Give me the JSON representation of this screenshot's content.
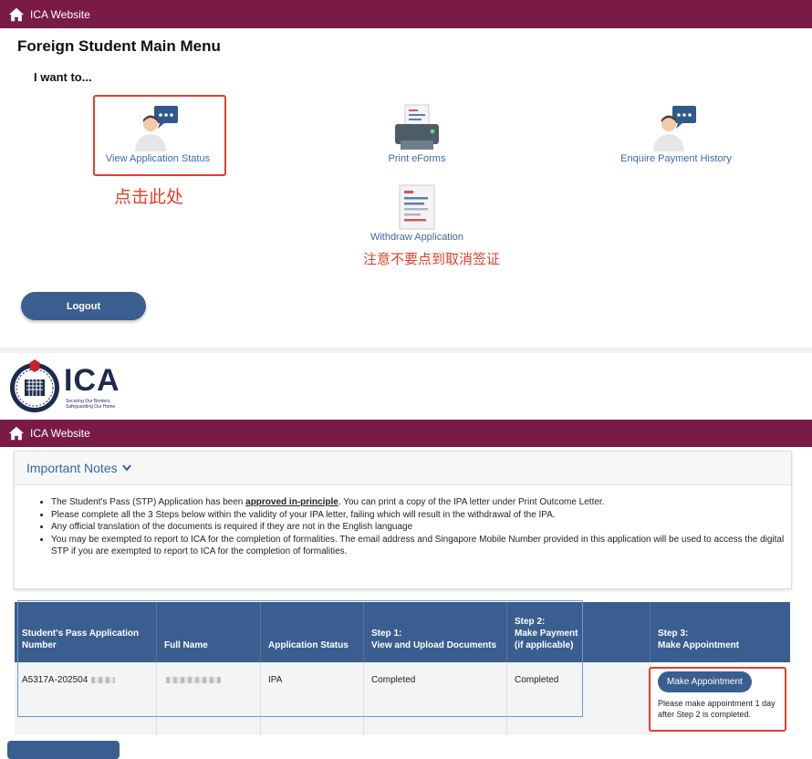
{
  "top_bar": {
    "label": "ICA Website"
  },
  "menu": {
    "title": "Foreign Student Main Menu",
    "subtitle": "I want to...",
    "tiles": [
      {
        "label": "View Application Status",
        "icon": "person-chat-icon"
      },
      {
        "label": "Print eForms",
        "icon": "printer-icon"
      },
      {
        "label": "Enquire Payment History",
        "icon": "person-chat-icon"
      },
      {
        "label": "Withdraw Application",
        "icon": "document-icon"
      }
    ],
    "annotation_click": "点击此处",
    "annotation_warning": "注意不要点到取消签证",
    "logout_label": "Logout"
  },
  "logo": {
    "text": "ICA",
    "tagline": "Securing Our Borders, Safeguarding Our Home"
  },
  "second_bar": {
    "label": "ICA Website"
  },
  "notes": {
    "heading": "Important Notes",
    "items": {
      "i0_pre": "The Student's Pass (STP) Application has been ",
      "i0_bold": "approved in-principle",
      "i0_post": ". You can print a copy of the IPA letter under Print Outcome Letter.",
      "i1": "Please complete all the 3 Steps below within the validity of your IPA letter, failing which will result in the withdrawal of the IPA.",
      "i2": "Any official translation of the documents is required if they are not in the English language",
      "i3": "You may be exempted to report to ICA for the completion of formalities. The email address and Singapore Mobile Number provided in this application will be used to access the digital STP if you are exempted to report to ICA for the completion of formalities."
    }
  },
  "table": {
    "headers": {
      "c0a": "Student's Pass Application",
      "c0b": "Number",
      "c1": "Full Name",
      "c2": "Application Status",
      "c3a": "Step 1:",
      "c3b": "View and Upload Documents",
      "c4a": "Step 2:",
      "c4b": "Make Payment",
      "c4c": "(if applicable)",
      "c5a": "Step 3:",
      "c5b": "Make Appointment"
    },
    "row": {
      "app_number": "A5317A-202504",
      "status": "IPA",
      "step1": "Completed",
      "step2": "Completed",
      "appointment_button": "Make Appointment",
      "appointment_note": "Please make appointment 1 day after Step 2 is completed."
    }
  },
  "colors": {
    "brand_bar": "#7a1a46",
    "accent": "#3a5e8f",
    "annotation_red": "#e0402a",
    "link_blue": "#3b6aa5"
  }
}
